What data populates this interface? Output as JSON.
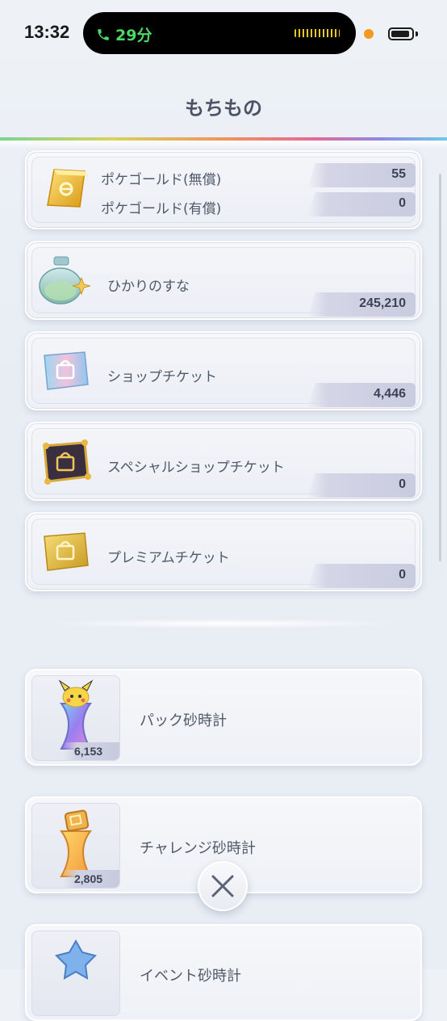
{
  "status_bar": {
    "time": "13:32",
    "call_duration": "29分",
    "accent_call": "#4cd964"
  },
  "header": {
    "title": "もちもの"
  },
  "items": [
    {
      "rows": [
        {
          "label": "ポケゴールド(無償)",
          "value": "55"
        },
        {
          "label": "ポケゴールド(有償)",
          "value": "0"
        }
      ],
      "icon": "gold-bar-icon"
    },
    {
      "label": "ひかりのすな",
      "value": "245,210",
      "icon": "stardust-bottle-icon"
    },
    {
      "label": "ショップチケット",
      "value": "4,446",
      "icon": "shop-ticket-icon"
    },
    {
      "label": "スペシャルショップチケット",
      "value": "0",
      "icon": "special-shop-ticket-icon"
    },
    {
      "label": "プレミアムチケット",
      "value": "0",
      "icon": "premium-ticket-icon"
    }
  ],
  "hourglasses": [
    {
      "label": "パック砂時計",
      "count": "6,153",
      "icon": "pack-hourglass-icon"
    },
    {
      "label": "チャレンジ砂時計",
      "count": "2,805",
      "icon": "challenge-hourglass-icon"
    },
    {
      "label": "イベント砂時計",
      "count": "",
      "icon": "event-hourglass-icon"
    }
  ],
  "close_button": {
    "icon": "close-icon"
  }
}
